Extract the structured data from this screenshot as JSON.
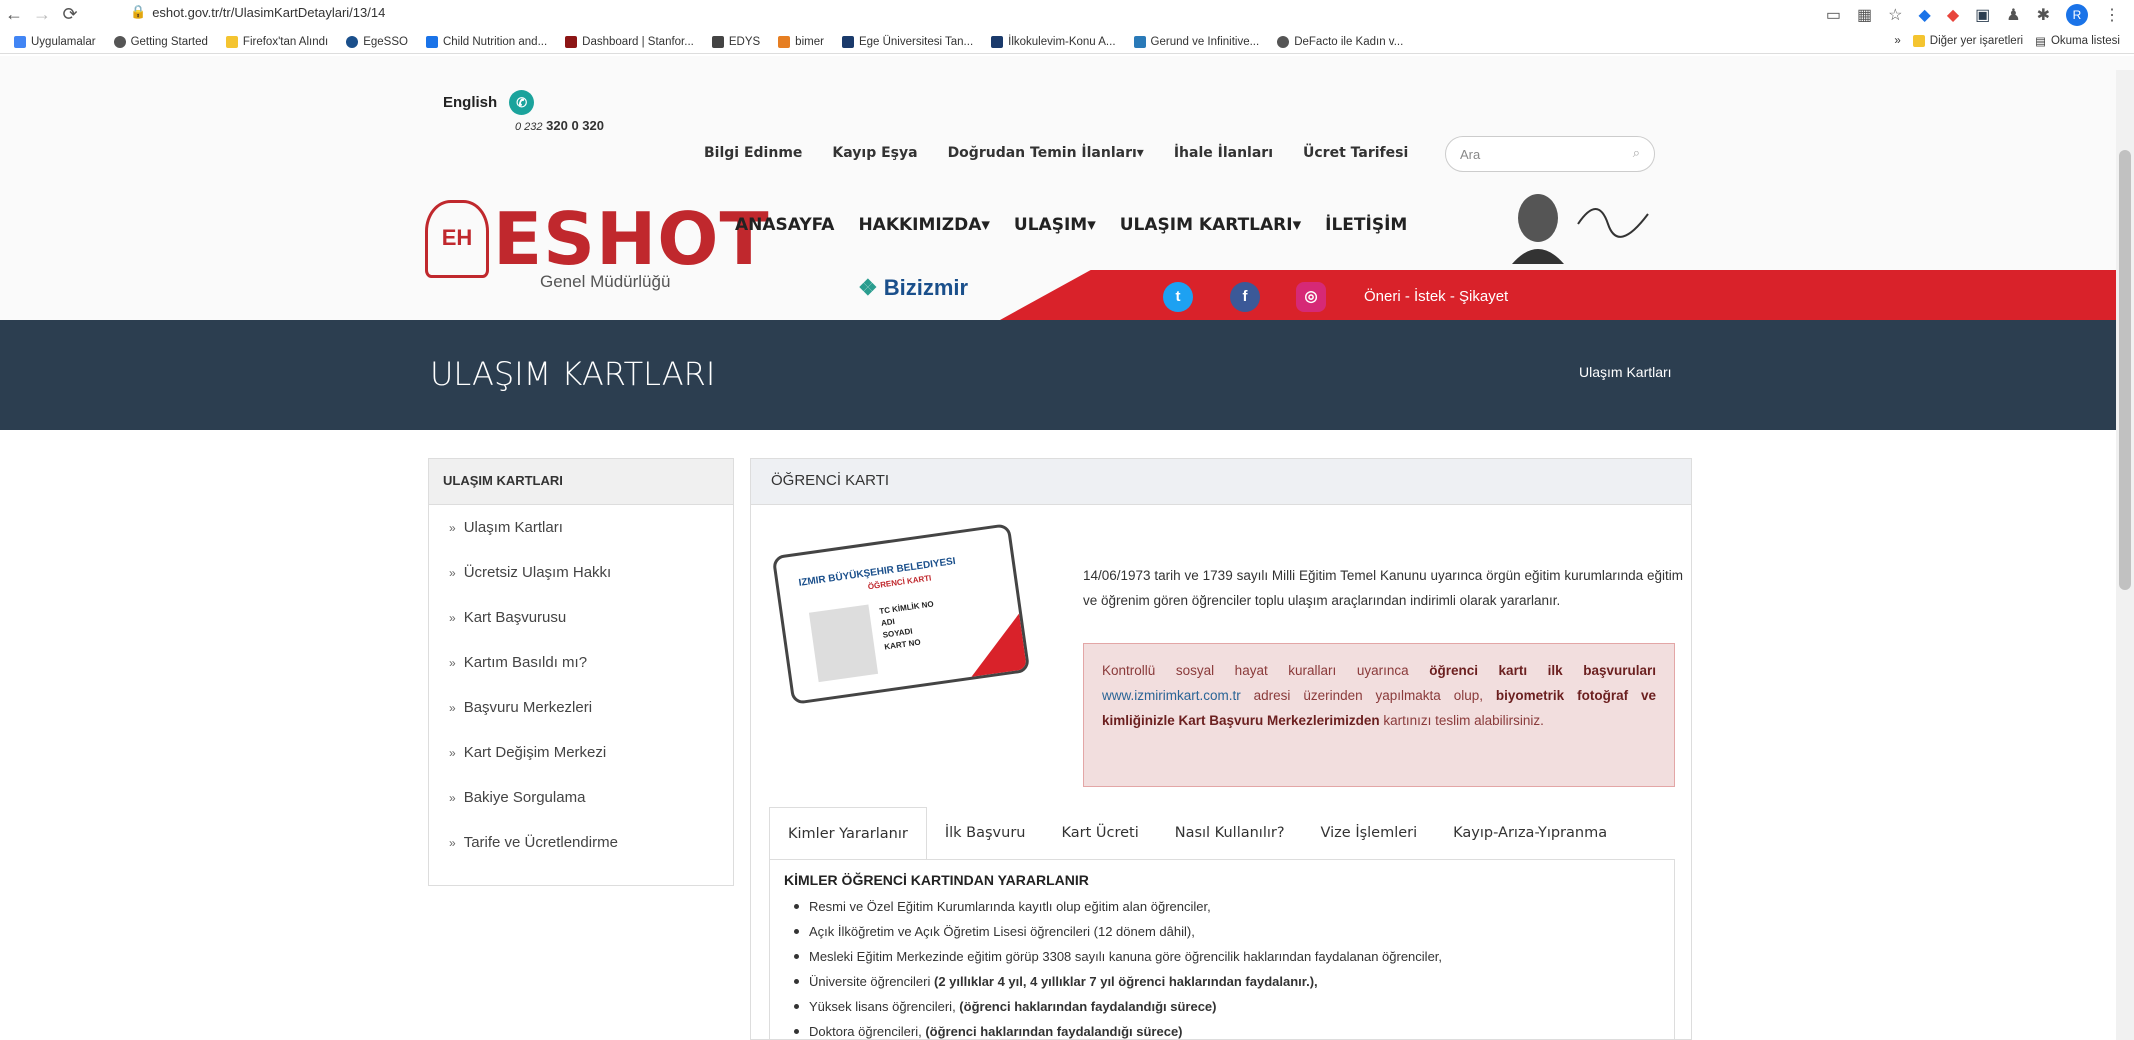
{
  "browser": {
    "url": "eshot.gov.tr/tr/UlasimKartDetaylari/13/14",
    "profile": "R"
  },
  "bookmarks": [
    "Uygulamalar",
    "Getting Started",
    "Firefox'tan Alındı",
    "EgeSSO",
    "Child Nutrition and...",
    "Dashboard | Stanfor...",
    "EDYS",
    "bimer",
    "Ege Üniversitesi Tan...",
    "İlkokulevim-Konu A...",
    "Gerund ve Infinitive...",
    "DeFacto ile Kadın v..."
  ],
  "bookmarks_right": {
    "more": "»",
    "other": "Diğer yer işaretleri",
    "reading": "Okuma listesi"
  },
  "header": {
    "lang": "English",
    "phone_prefix": "0 232",
    "phone": "320 0 320",
    "topnav": [
      "Bilgi Edinme",
      "Kayıp Eşya",
      "Doğrudan Temin İlanları",
      "İhale İlanları",
      "Ücret Tarifesi"
    ],
    "search_placeholder": "Ara",
    "logo": "ESHOT",
    "logo_sub": "Genel Müdürlüğü",
    "mainnav": [
      "ANASAYFA",
      "HAKKIMIZDA",
      "ULAŞIM",
      "ULAŞIM KARTLARI",
      "İLETİŞİM"
    ],
    "bizizmir": "Bizizmir",
    "oneri": "Öneri - İstek - Şikayet"
  },
  "page": {
    "title": "ULAŞIM KARTLARI",
    "breadcrumb": "Ulaşım Kartları"
  },
  "sidebar": {
    "heading": "ULAŞIM KARTLARI",
    "items": [
      "Ulaşım Kartları",
      "Ücretsiz Ulaşım Hakkı",
      "Kart Başvurusu",
      "Kartım Basıldı mı?",
      "Başvuru Merkezleri",
      "Kart Değişim Merkezi",
      "Bakiye Sorgulama",
      "Tarife ve Ücretlendirme"
    ]
  },
  "content": {
    "heading": "ÖĞRENCİ KARTI",
    "card": {
      "org": "IZMIR BÜYÜKŞEHIR BELEDIYESI",
      "type": "ÖĞRENCİ KARTI",
      "f1": "TC KİMLİK NO",
      "f2": "ADI",
      "f3": "SOYADI",
      "f4": "KART NO"
    },
    "intro": "14/06/1973 tarih ve 1739 sayılı Milli Eğitim Temel Kanunu uyarınca örgün eğitim kurumlarında eğitim ve öğrenim gören öğrenciler toplu ulaşım araçlarından indirimli olarak yararlanır.",
    "alert": {
      "p1": "Kontrollü sosyal hayat kuralları uyarınca ",
      "b1": "öğrenci kartı ilk başvuruları",
      "link": "www.izmirimkart.com.tr",
      "p2": " adresi üzerinden yapılmakta olup, ",
      "b2": "biyometrik fotoğraf ve kimliğinizle Kart Başvuru Merkezlerimizden",
      "p3": " kartınızı teslim alabilirsiniz."
    },
    "tabs": [
      "Kimler Yararlanır",
      "İlk Başvuru",
      "Kart Ücreti",
      "Nasıl Kullanılır?",
      "Vize İşlemleri",
      "Kayıp-Arıza-Yıpranma"
    ],
    "tab_title": "KİMLER ÖĞRENCİ KARTINDAN YARARLANIR",
    "list": [
      "Resmi ve Özel Eğitim Kurumlarında kayıtlı olup eğitim alan öğrenciler,",
      "Açık İlköğretim ve Açık Öğretim Lisesi öğrencileri (12 dönem dâhil),",
      "Mesleki Eğitim Merkezinde eğitim görüp 3308 sayılı kanuna göre öğrencilik haklarından faydalanan öğrenciler,"
    ],
    "list4": {
      "pre": "Üniversite öğrencileri ",
      "bold": "(2 yıllıklar 4 yıl, 4 yıllıklar 7 yıl öğrenci haklarından faydalanır.),"
    },
    "list5": {
      "pre": "Yüksek lisans öğrencileri, ",
      "bold": "(öğrenci haklarından faydalandığı sürece)"
    },
    "list6": {
      "pre": "Doktora öğrencileri, ",
      "bold": "(öğrenci haklarından faydalandığı sürece)"
    }
  },
  "colors": {
    "brand_red": "#c0282d",
    "nav_dark": "#2c3e50",
    "alert_bg": "#f2dede"
  }
}
